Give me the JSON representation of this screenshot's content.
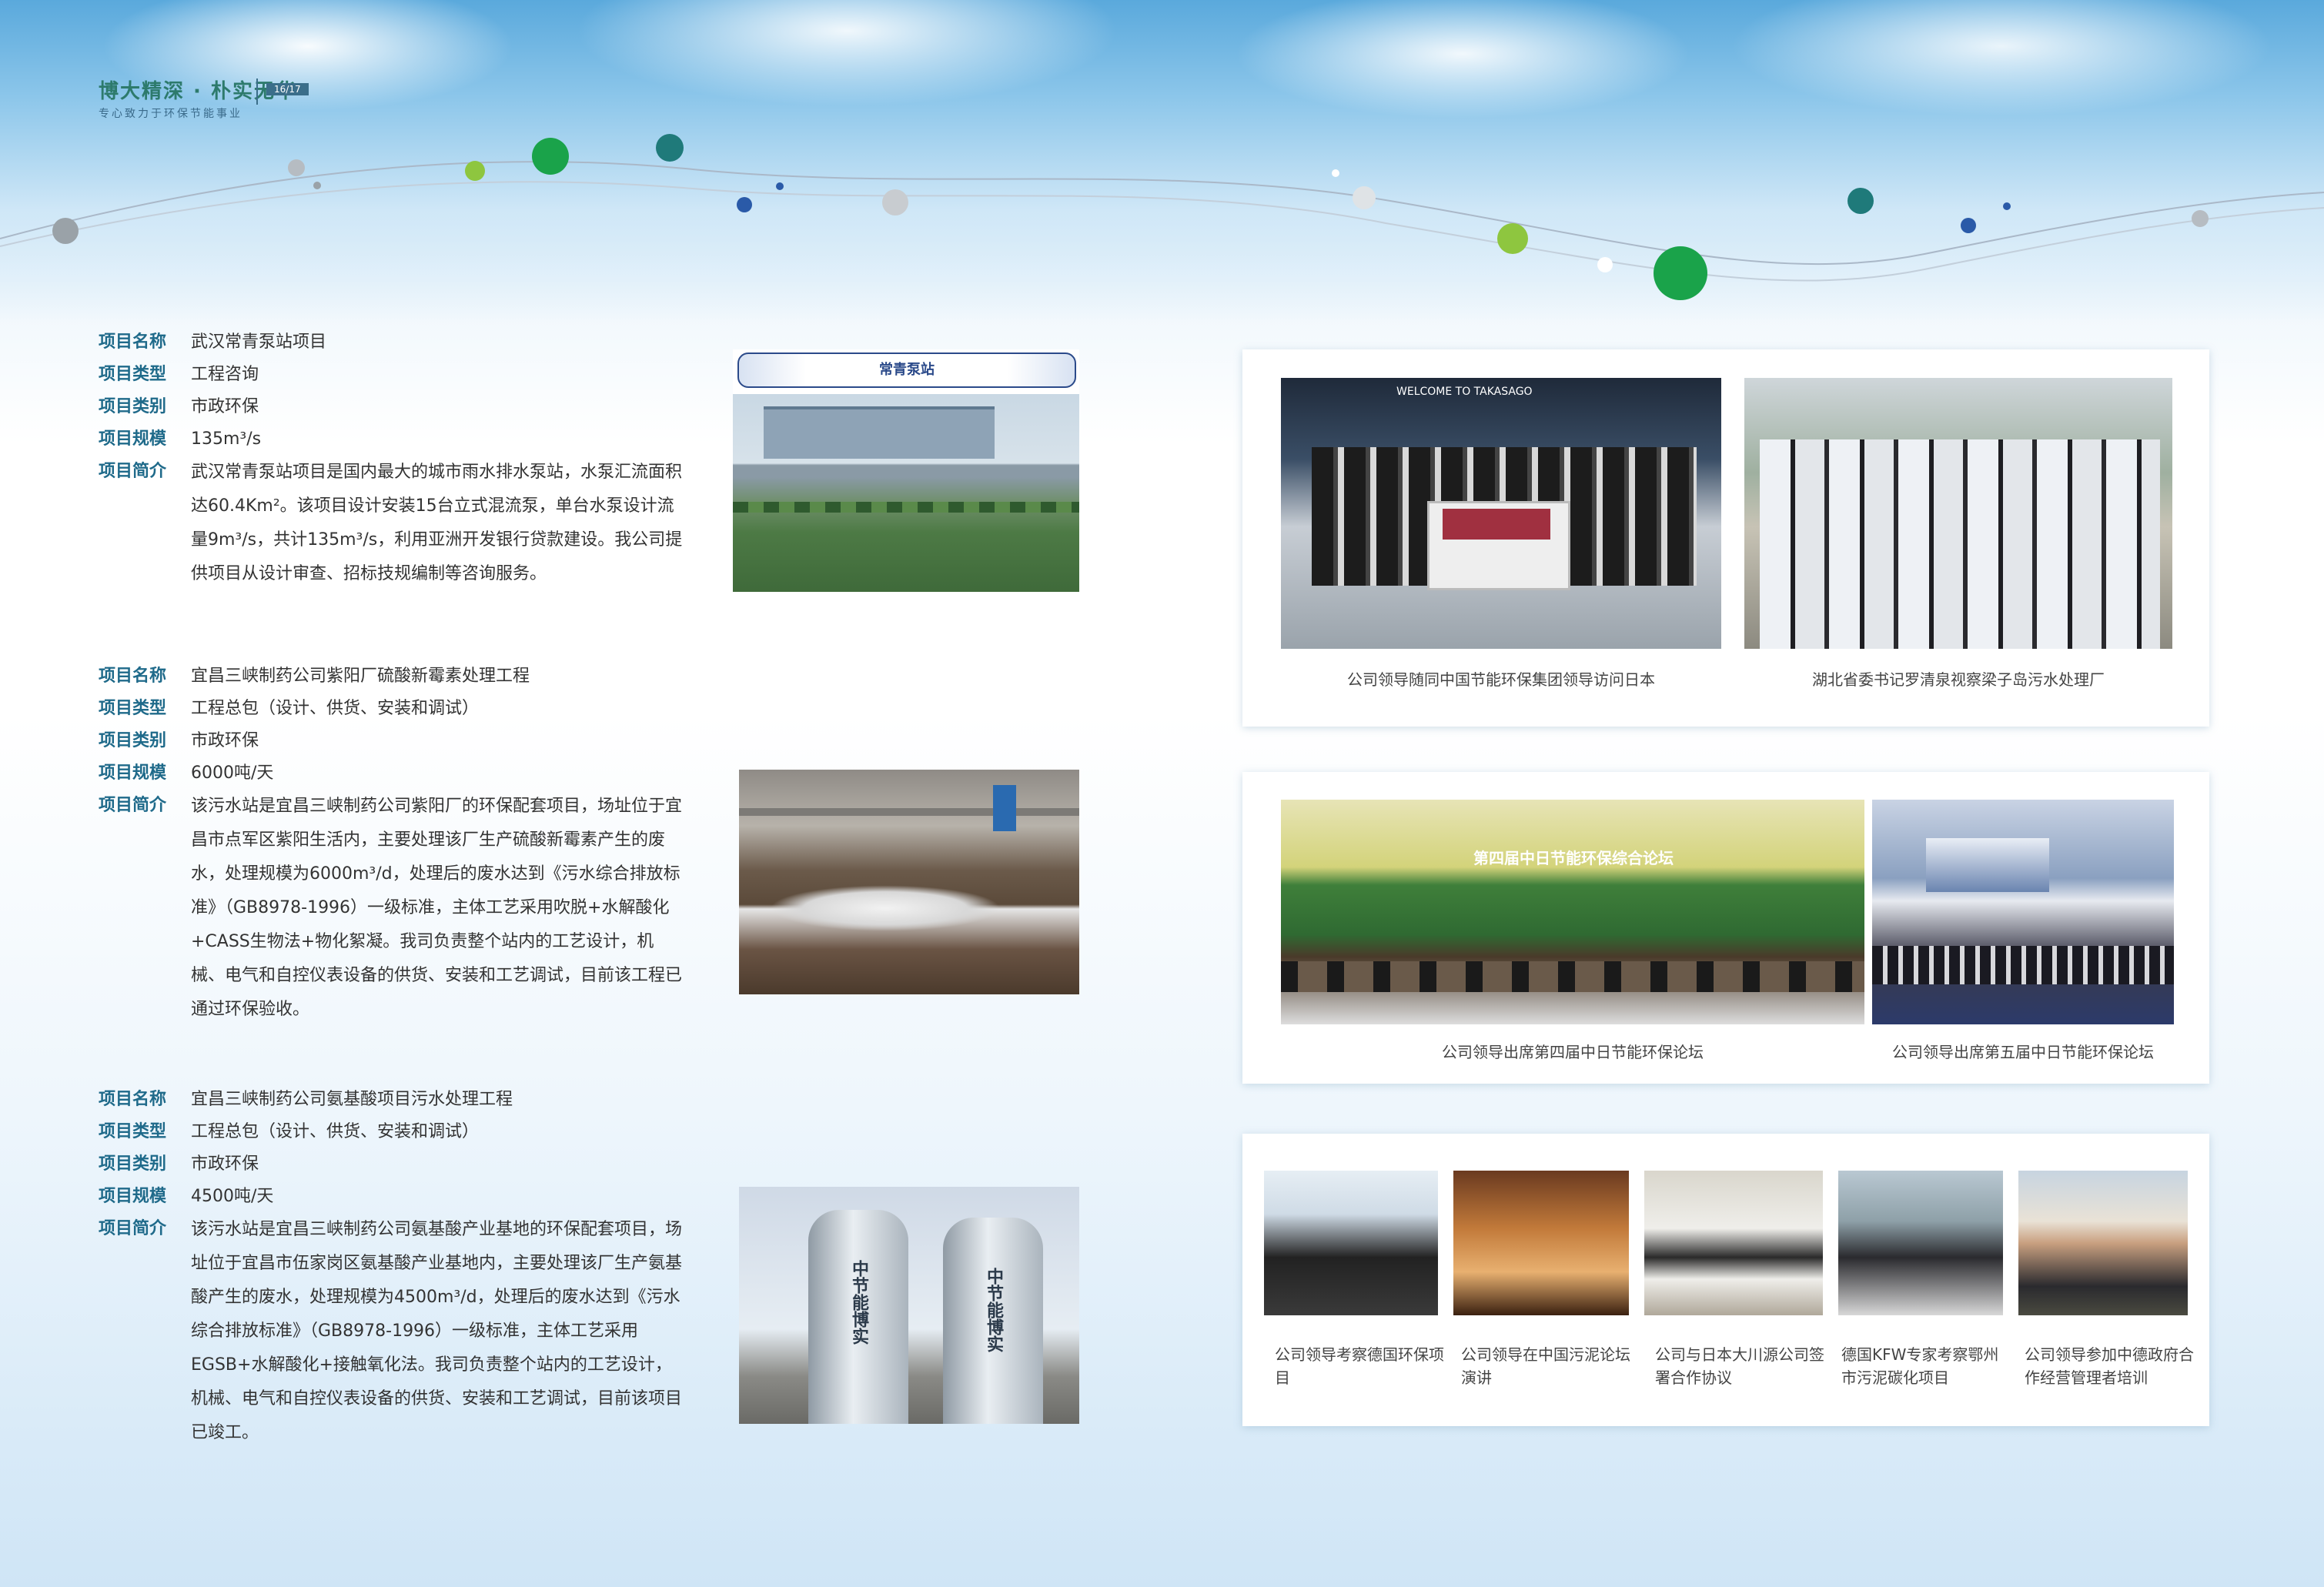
{
  "header": {
    "slogan": "博大精深 · 朴实无华",
    "tagline": "专心致力于环保节能事业",
    "page_number": "16/17"
  },
  "colors": {
    "label": "#1f6a8a",
    "brand": "#2d7a6c",
    "dot_green": "#1aa34a",
    "dot_teal": "#1f7a7a",
    "dot_blue": "#2a5aa8"
  },
  "labels": {
    "name": "项目名称",
    "type": "项目类型",
    "category": "项目类别",
    "scale": "项目规模",
    "intro": "项目简介"
  },
  "projects": [
    {
      "name": "武汉常青泵站项目",
      "type": "工程咨询",
      "category": "市政环保",
      "scale": "135m³/s",
      "intro": "武汉常青泵站项目是国内最大的城市雨水排水泵站，水泵汇流面积达60.4Km²。该项目设计安装15台立式混流泵，单台水泵设计流量9m³/s，共计135m³/s，利用亚洲开发银行贷款建设。我公司提供项目从设计审查、招标技规编制等咨询服务。",
      "photo_caption": "常青泵站"
    },
    {
      "name": "宜昌三峡制药公司紫阳厂硫酸新霉素处理工程",
      "type": "工程总包（设计、供货、安装和调试）",
      "category": "市政环保",
      "scale": "6000吨/天",
      "intro": "该污水站是宜昌三峡制药公司紫阳厂的环保配套项目，场址位于宜昌市点军区紫阳生活内，主要处理该厂生产硫酸新霉素产生的废水，处理规模为6000m³/d，处理后的废水达到《污水综合排放标准》（GB8978-1996）一级标准，主体工艺采用吹脱+水解酸化+CASS生物法+物化絮凝。我司负责整个站内的工艺设计，机械、电气和自控仪表设备的供货、安装和工艺调试，目前该工程已通过环保验收。"
    },
    {
      "name": "宜昌三峡制药公司氨基酸项目污水处理工程",
      "type": "工程总包（设计、供货、安装和调试）",
      "category": "市政环保",
      "scale": "4500吨/天",
      "intro": "该污水站是宜昌三峡制药公司氨基酸产业基地的环保配套项目，场址位于宜昌市伍家岗区氨基酸产业基地内，主要处理该厂生产氨基酸产生的废水，处理规模为4500m³/d，处理后的废水达到《污水综合排放标准》（GB8978-1996）一级标准，主体工艺采用EGSB+水解酸化+接触氧化法。我司负责整个站内的工艺设计，机械、电气和自控仪表设备的供货、安装和工艺调试，目前该项目已竣工。",
      "tank_text_1": "中节能博实",
      "tank_text_2": "中节能博实"
    }
  ],
  "gallery": {
    "card1": [
      "公司领导随同中国节能环保集团领导访问日本",
      "湖北省委书记罗清泉视察梁子岛污水处理厂"
    ],
    "card1_banner": "WELCOME TO TAKASAGO",
    "card2": [
      "公司领导出席第四届中日节能环保论坛",
      "公司领导出席第五届中日节能环保论坛"
    ],
    "card2_banner": "第四届中日节能环保综合论坛",
    "card3": [
      "公司领导考察德国环保项目",
      "公司领导在中国污泥论坛演讲",
      "公司与日本大川源公司签署合作协议",
      "德国KFW专家考察鄂州市污泥碳化项目",
      "公司领导参加中德政府合作经营管理者培训"
    ]
  }
}
